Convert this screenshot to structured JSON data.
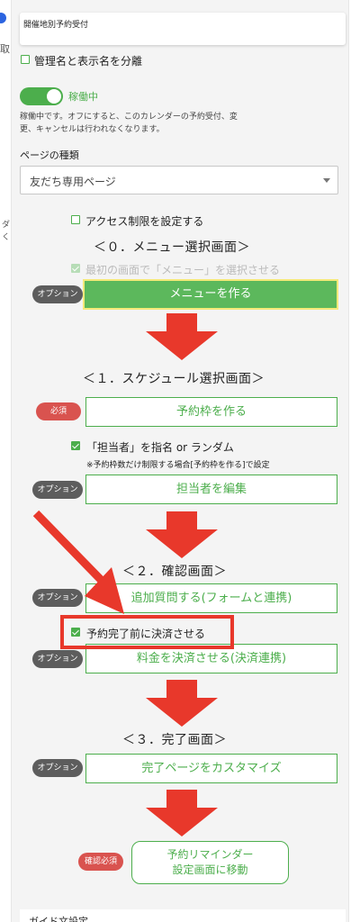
{
  "side": {
    "left_char": "取",
    "left_frag1": "ダ",
    "left_frag2": "く",
    "right_marks": [
      "2",
      "※",
      "※",
      "ま",
      "※",
      "※"
    ]
  },
  "title_box": {
    "label": "開催地別予約受付"
  },
  "separate_names": {
    "label": "管理名と表示名を分離",
    "checked": false
  },
  "status": {
    "toggle_label": "稼働中",
    "on": true,
    "desc_line1": "稼働中です。オフにすると、このカレンダーの予約受付、変",
    "desc_line2": "更、キャンセルは行われなくなります。"
  },
  "page_type": {
    "label": "ページの種類",
    "value": "友だち専用ページ"
  },
  "access_limit": {
    "label": "アクセス制限を設定する",
    "checked": false
  },
  "section0": {
    "heading": "＜０．メニュー選択画面＞",
    "checkbox_label": "最初の画面で「メニュー」を選択させる",
    "badge": "オプション",
    "button": "メニューを作る"
  },
  "section1": {
    "heading": "＜１．スケジュール選択画面＞",
    "badge_required": "必須",
    "button_slots": "予約枠を作る",
    "staff_checkbox": "「担当者」を指名 or ランダム",
    "staff_note": "※予約枠数だけ制限する場合[予約枠を作る]で設定",
    "badge_option": "オプション",
    "button_staff": "担当者を編集"
  },
  "section2": {
    "heading": "＜２．確認画面＞",
    "badge_option": "オプション",
    "button_questions": "追加質問する(フォームと連携)",
    "payment_checkbox": "予約完了前に決済させる",
    "badge_option2": "オプション",
    "button_payment": "料金を決済させる(決済連携)"
  },
  "section3": {
    "heading": "＜３．完了画面＞",
    "badge_option": "オプション",
    "button_complete": "完了ページをカスタマイズ"
  },
  "reminder": {
    "badge": "確認必須",
    "button_line1": "予約リマインダー",
    "button_line2": "設定画面に移動"
  },
  "footer_partial": "ガイド文設定",
  "colors": {
    "green": "#4cae4c",
    "red_annotation": "#e8382b",
    "badge_gray": "#5d5d5d",
    "badge_red": "#d9534f"
  }
}
